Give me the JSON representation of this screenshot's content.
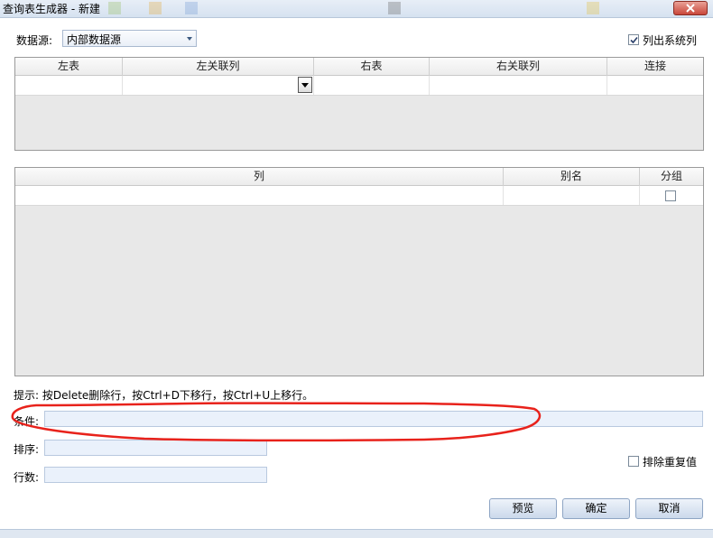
{
  "window": {
    "title": "查询表生成器 - 新建"
  },
  "datasource": {
    "label": "数据源:",
    "value": "内部数据源"
  },
  "list_system_columns": {
    "label": "列出系统列",
    "checked": true
  },
  "join_grid": {
    "columns": [
      "左表",
      "左关联列",
      "右表",
      "右关联列",
      "连接"
    ]
  },
  "column_grid": {
    "columns": [
      "列",
      "别名",
      "分组"
    ],
    "group_checked": false
  },
  "hint": "提示: 按Delete删除行，按Ctrl+D下移行，按Ctrl+U上移行。",
  "condition": {
    "label": "条件:",
    "value": ""
  },
  "sort": {
    "label": "排序:",
    "value": ""
  },
  "rows": {
    "label": "行数:",
    "value": ""
  },
  "exclude_duplicates": {
    "label": "排除重复值",
    "checked": false
  },
  "buttons": {
    "preview": "预览",
    "ok": "确定",
    "cancel": "取消"
  },
  "colors": {
    "annotation": "#e8221b",
    "field_bg": "#eaf1fb",
    "grid_bg": "#e8e8e8"
  }
}
